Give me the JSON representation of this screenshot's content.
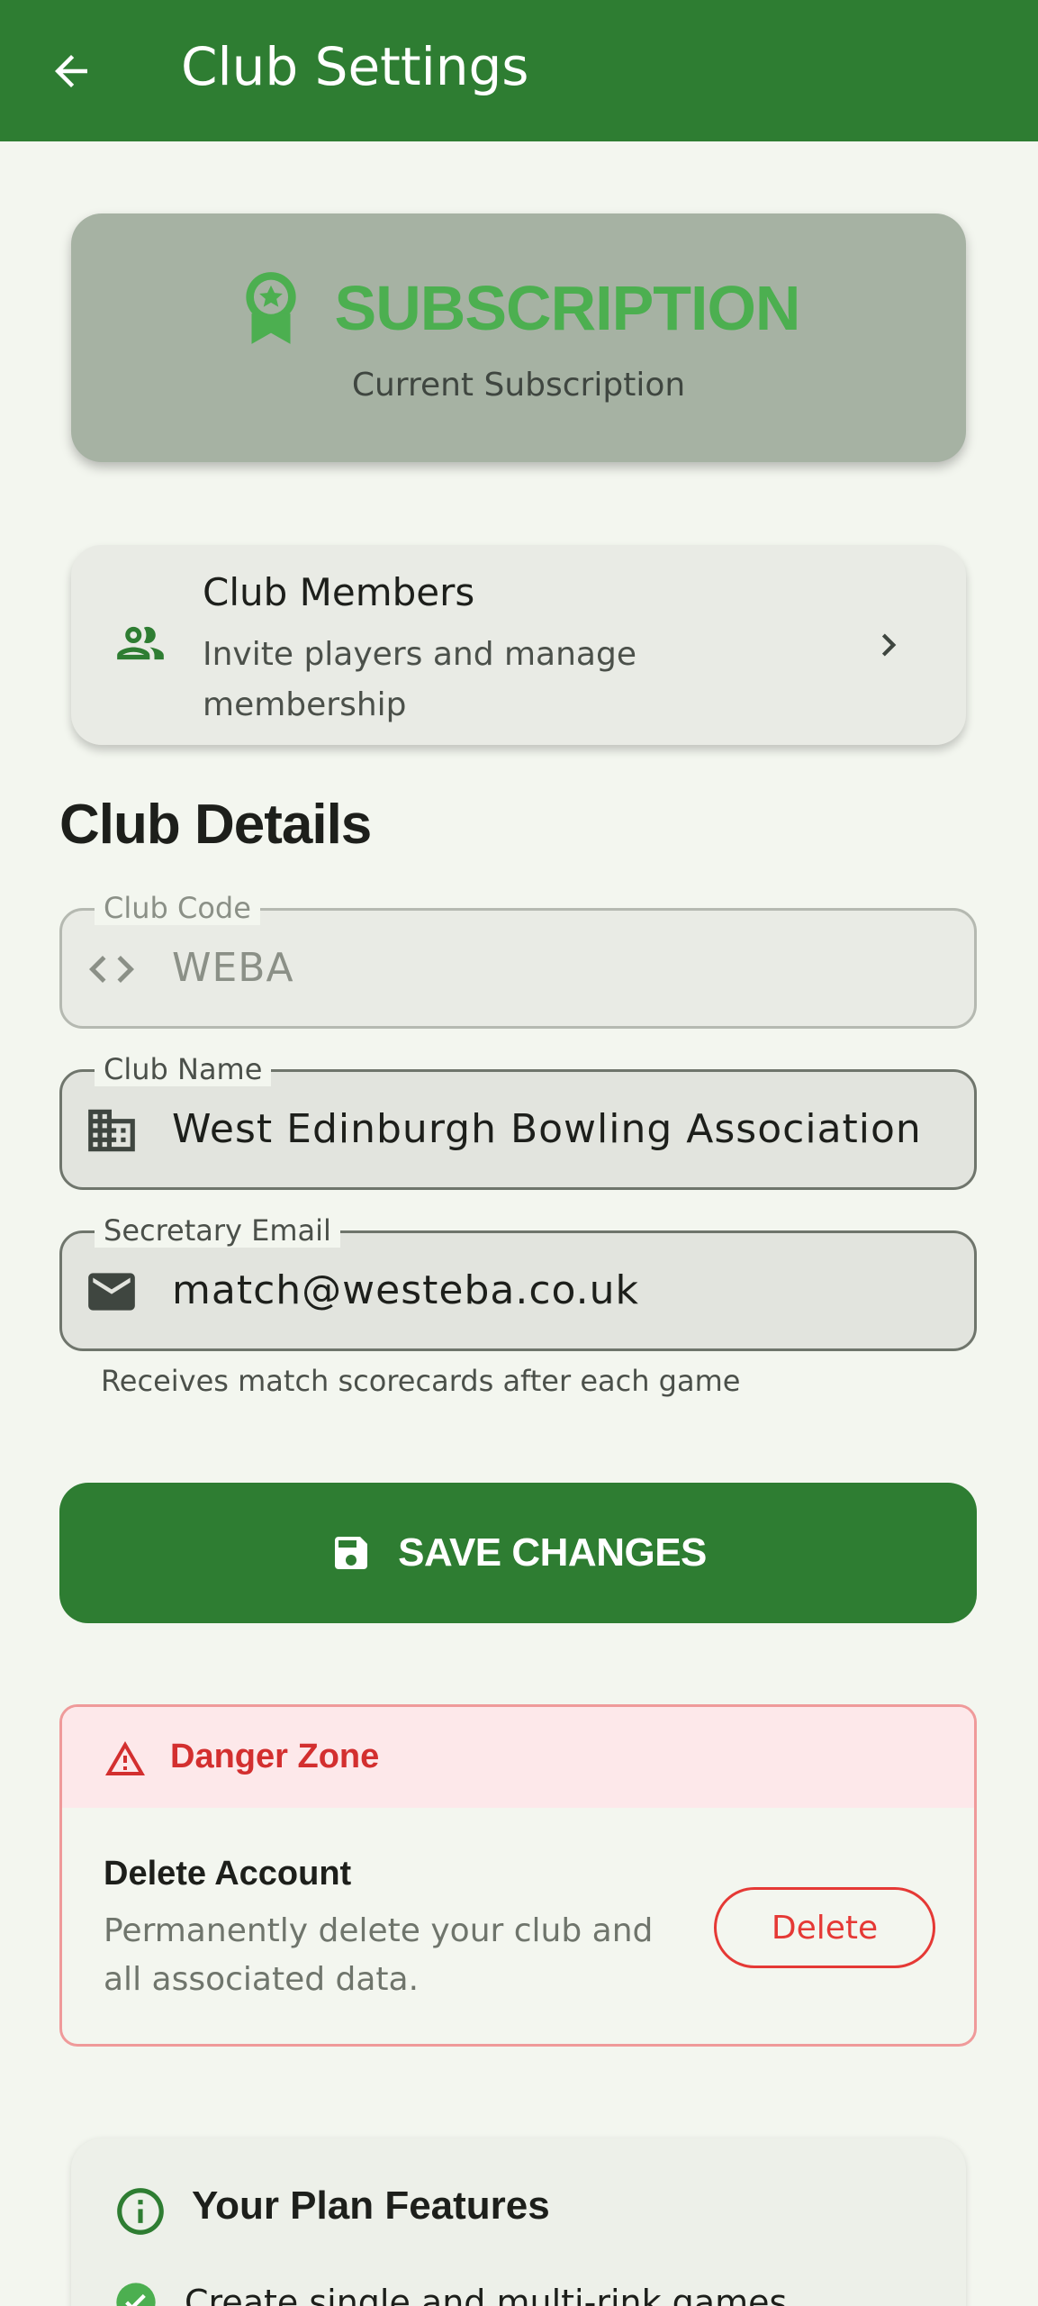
{
  "appbar": {
    "title": "Club Settings",
    "back_icon": "arrow-back-icon"
  },
  "subscription": {
    "title": "SUBSCRIPTION",
    "caption": "Current Subscription",
    "icon": "award-badge-icon",
    "accent": "#4caf50"
  },
  "members": {
    "title": "Club Members",
    "subtitle": "Invite players and manage membership",
    "icon": "people-icon"
  },
  "details": {
    "title": "Club Details",
    "club_code": {
      "label": "Club Code",
      "value": "WEBA",
      "icon": "code-icon"
    },
    "club_name": {
      "label": "Club Name",
      "value": "West Edinburgh Bowling Association",
      "icon": "building-icon"
    },
    "secretary_email": {
      "label": "Secretary Email",
      "value": "match@westeba.co.uk",
      "icon": "mail-icon",
      "helper": "Receives match scorecards after each game"
    }
  },
  "save": {
    "label": "SAVE CHANGES",
    "icon": "save-icon"
  },
  "danger": {
    "title": "Danger Zone",
    "delete_title": "Delete Account",
    "delete_desc": "Permanently delete your club and all associated data.",
    "delete_button": "Delete",
    "color": "#d32f2f"
  },
  "plan": {
    "title": "Your Plan Features",
    "features": [
      "Create single and multi-rink games"
    ]
  },
  "colors": {
    "primary": "#2e7d32",
    "background": "#f3f6ef"
  }
}
